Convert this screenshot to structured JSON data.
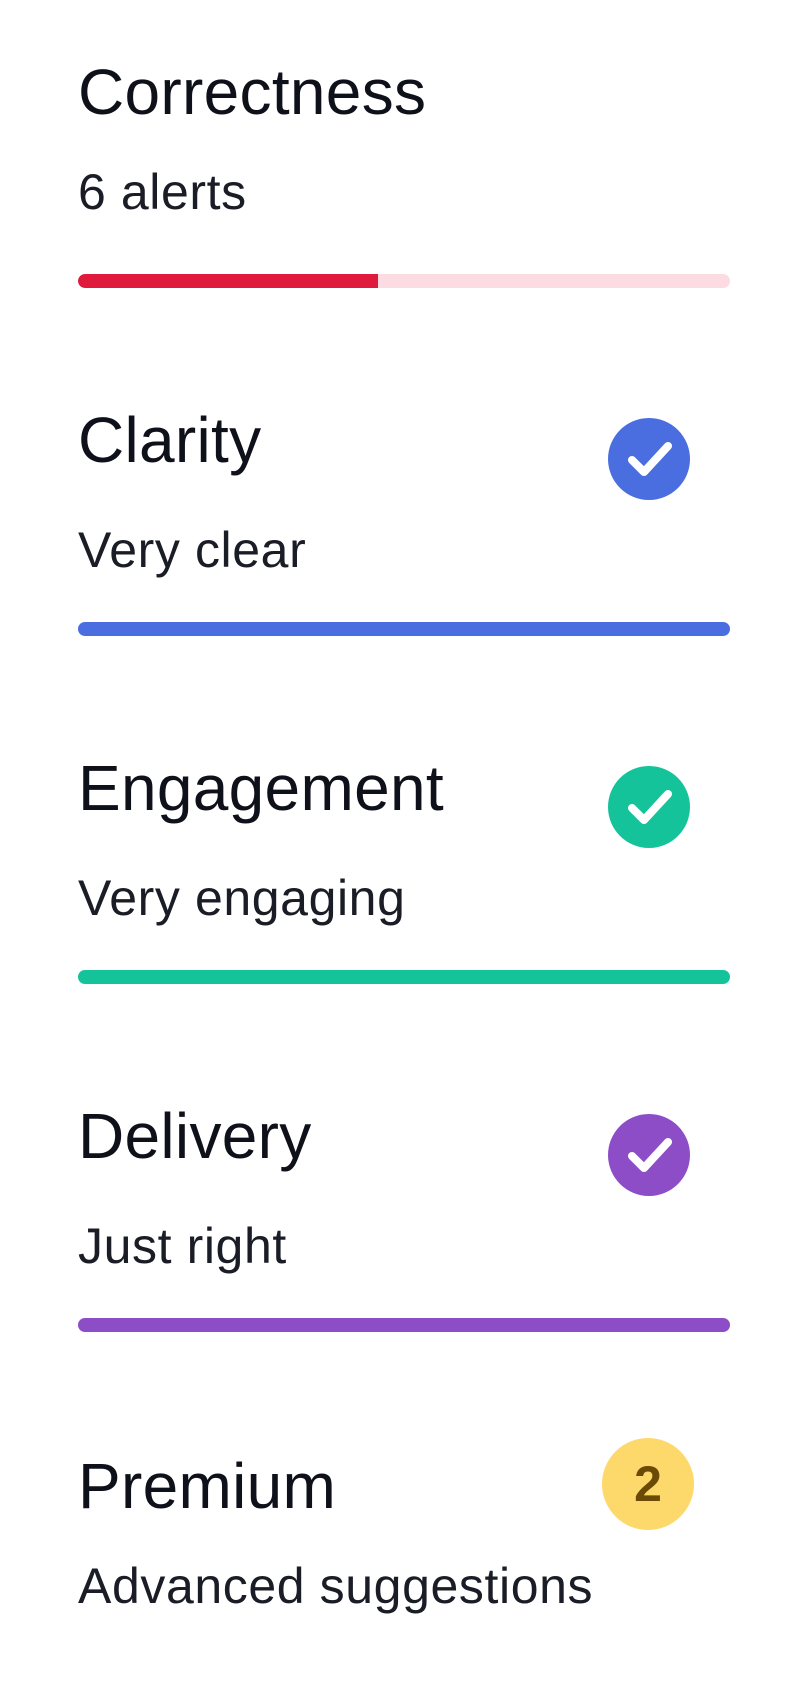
{
  "sections": {
    "correctness": {
      "title": "Correctness",
      "subtitle": "6 alerts",
      "progress": 0.46,
      "color": "#e01a3c",
      "track_color": "#fddbe2"
    },
    "clarity": {
      "title": "Clarity",
      "subtitle": "Very clear",
      "color": "#4a6ee0",
      "icon": "check-circle-icon"
    },
    "engagement": {
      "title": "Engagement",
      "subtitle": "Very engaging",
      "color": "#15c39a",
      "icon": "check-circle-icon"
    },
    "delivery": {
      "title": "Delivery",
      "subtitle": "Just right",
      "color": "#8c4dc7",
      "icon": "check-circle-icon"
    },
    "premium": {
      "title": "Premium",
      "subtitle": "Advanced suggestions",
      "badge_count": "2",
      "badge_color": "#fdd86a"
    }
  }
}
